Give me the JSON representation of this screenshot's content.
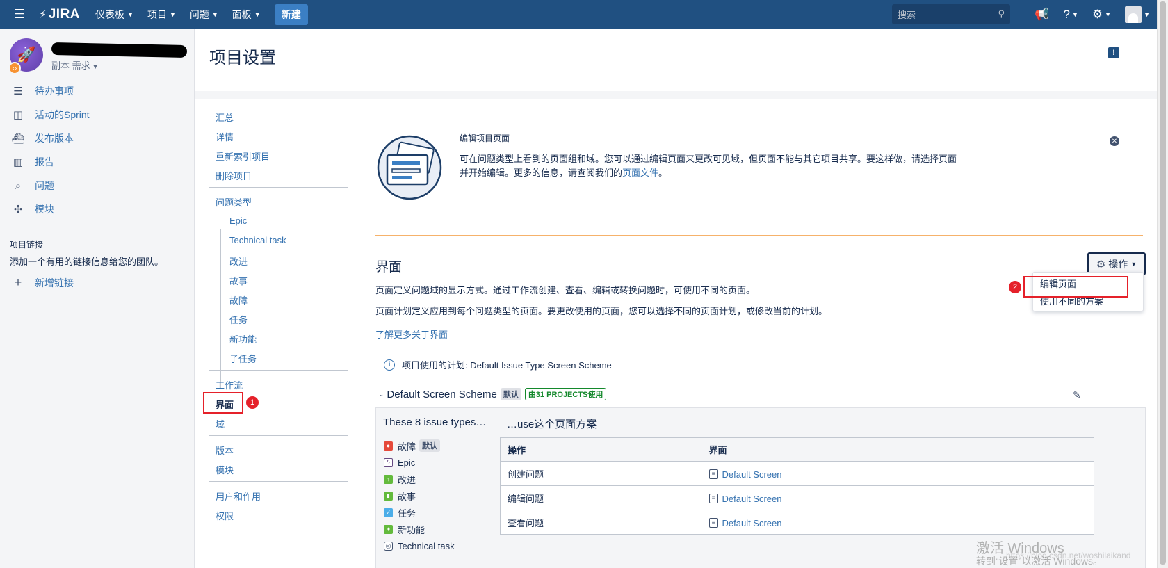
{
  "topnav": {
    "logo": "JIRA",
    "items": [
      {
        "label": "仪表板"
      },
      {
        "label": "项目"
      },
      {
        "label": "问题"
      },
      {
        "label": "面板"
      }
    ],
    "create_label": "新建",
    "search_placeholder": "搜索"
  },
  "sidebar": {
    "project_sub": "副本 需求",
    "items": [
      {
        "label": "待办事项"
      },
      {
        "label": "活动的Sprint"
      },
      {
        "label": "发布版本"
      },
      {
        "label": "报告"
      },
      {
        "label": "问题"
      },
      {
        "label": "模块"
      }
    ],
    "project_links_heading": "项目链接",
    "project_links_desc": "添加一个有用的链接信息给您的团队。",
    "add_link": "新增链接"
  },
  "page": {
    "title": "项目设置"
  },
  "settings_nav": {
    "group1": [
      "汇总",
      "详情",
      "重新索引项目",
      "删除项目"
    ],
    "issue_types_label": "问题类型",
    "issue_types": [
      "Epic",
      "Technical task",
      "改进",
      "故事",
      "故障",
      "任务",
      "新功能",
      "子任务"
    ],
    "workflow": "工作流",
    "screens": "界面",
    "fields": "域",
    "versions": "版本",
    "components": "模块",
    "users_roles": "用户和作用",
    "permissions": "权限",
    "badge1": "1"
  },
  "info_panel": {
    "title": "编辑项目页面",
    "text_pre": "可在问题类型上看到的页面组和域。您可以通过编辑页面来更改可见域，但页面不能与其它项目共享。要这样做，请选择页面并开始编辑。更多的信息，请查阅我们的",
    "link": "页面文件",
    "text_post": "。"
  },
  "screens_section": {
    "title": "界面",
    "ops_label": "操作",
    "dropdown": [
      "编辑页面",
      "使用不同的方案"
    ],
    "badge2": "2",
    "desc1": "页面定义问题域的显示方式。通过工作流创建、查看、编辑或转换问题时，可使用不同的页面。",
    "desc2": "页面计划定义应用到每个问题类型的页面。要更改使用的页面，您可以选择不同的页面计划，或修改当前的计划。",
    "learn_more": "了解更多关于界面",
    "plan_text": "项目使用的计划: Default Issue Type Screen Scheme"
  },
  "scheme": {
    "name": "Default Screen Scheme",
    "default_badge": "默认",
    "used_badge": "由31 PROJECTS使用",
    "issue_types_heading": "These 8 issue types…",
    "use_heading": "…use这个页面方案",
    "issue_types": [
      {
        "label": "故障",
        "badge": "默认",
        "color": "#e5493a"
      },
      {
        "label": "Epic",
        "badge": "",
        "color": "#654982"
      },
      {
        "label": "改进",
        "badge": "",
        "color": "#63ba3c"
      },
      {
        "label": "故事",
        "badge": "",
        "color": "#63ba3c"
      },
      {
        "label": "任务",
        "badge": "",
        "color": "#4bade8"
      },
      {
        "label": "新功能",
        "badge": "",
        "color": "#63ba3c"
      },
      {
        "label": "Technical task",
        "badge": "",
        "color": "#42526e"
      }
    ],
    "table_headers": [
      "操作",
      "界面"
    ],
    "table_rows": [
      {
        "op": "创建问题",
        "screen": "Default Screen"
      },
      {
        "op": "编辑问题",
        "screen": "Default Screen"
      },
      {
        "op": "查看问题",
        "screen": "Default Screen"
      }
    ]
  },
  "watermark": {
    "line1": "激活 Windows",
    "line2": "转到“设置”以激活 Windows。",
    "url": "https://blog.csdn.net/woshilaikand"
  }
}
